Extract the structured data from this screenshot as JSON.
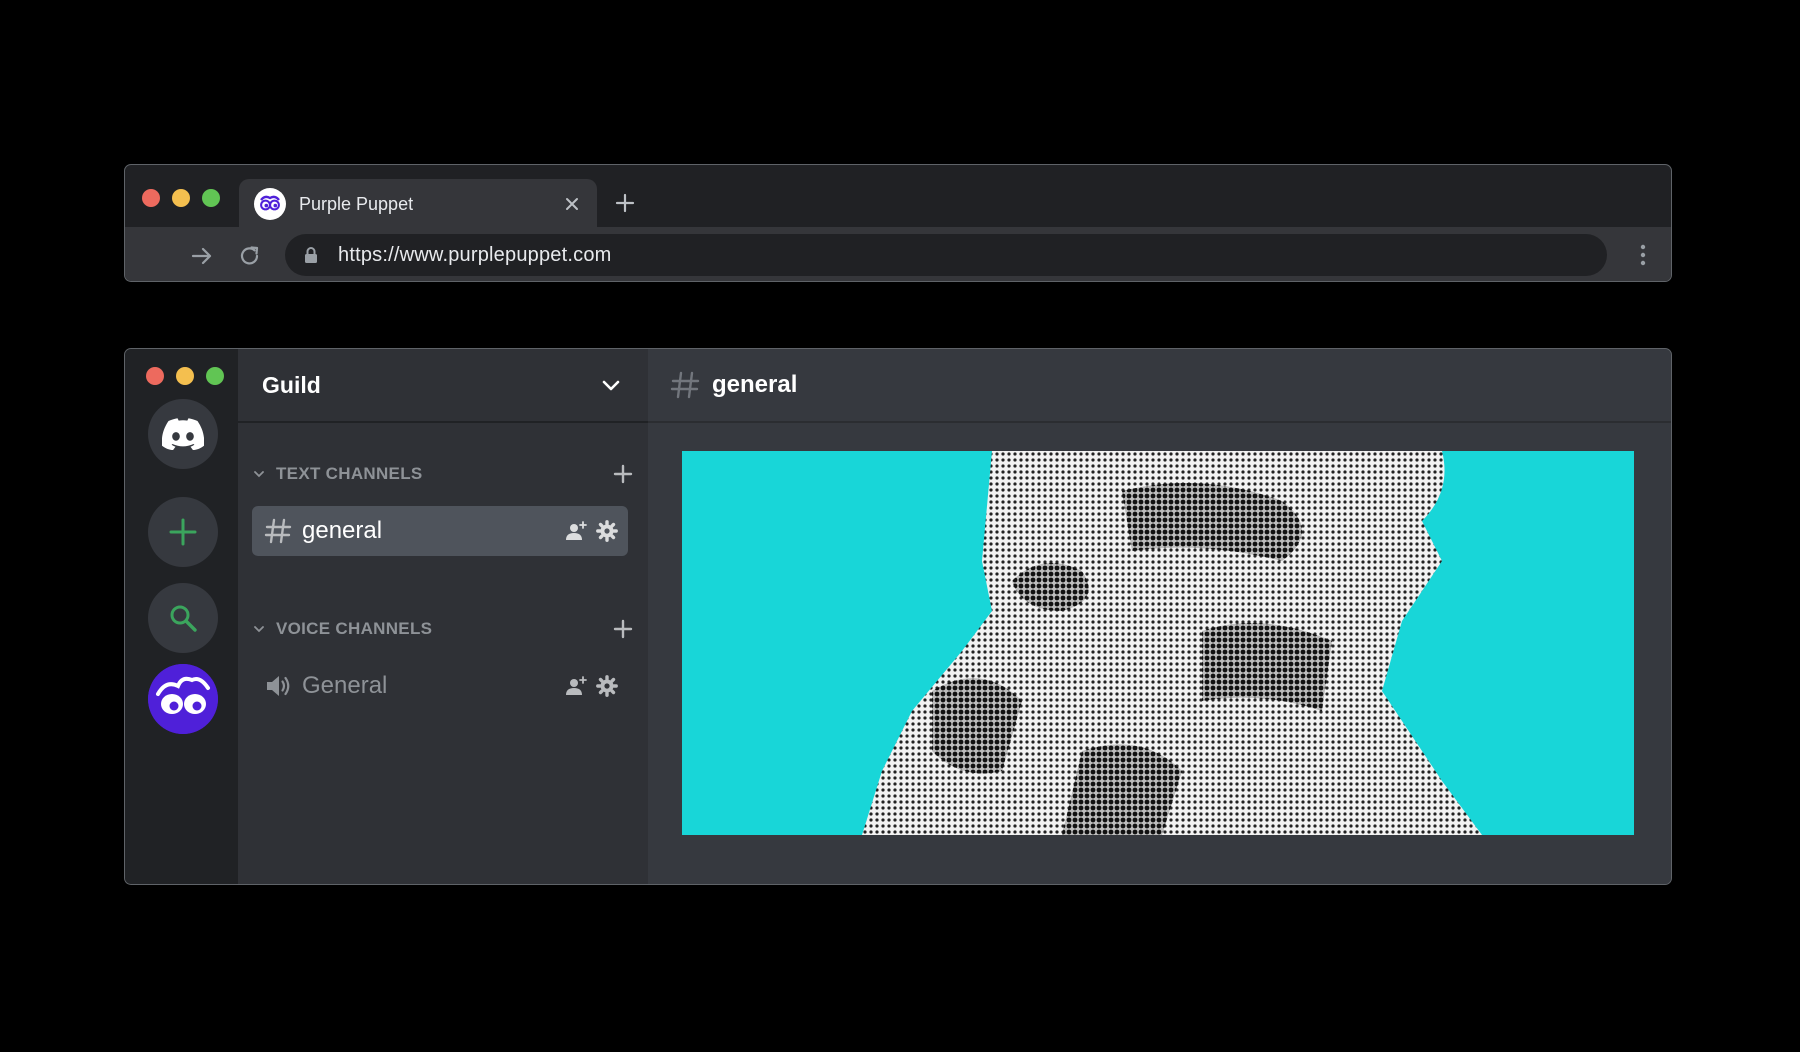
{
  "browser": {
    "tab": {
      "title": "Purple Puppet",
      "favicon_icon": "purple-puppet-logo-icon",
      "close_icon": "close-icon"
    },
    "new_tab_icon": "plus-icon",
    "toolbar": {
      "forward_icon": "arrow-right-icon",
      "reload_icon": "reload-icon",
      "lock_icon": "lock-icon",
      "url": "https://www.purplepuppet.com",
      "menu_icon": "kebab-menu-icon"
    }
  },
  "discord": {
    "guild_rail": {
      "items": [
        {
          "name": "home",
          "icon": "discord-logo-icon"
        },
        {
          "name": "add-server",
          "icon": "plus-icon"
        },
        {
          "name": "explore",
          "icon": "search-icon"
        },
        {
          "name": "purple-puppet-server",
          "icon": "purple-puppet-logo-icon"
        }
      ]
    },
    "guild": {
      "name": "Guild",
      "menu_icon": "chevron-down-icon"
    },
    "categories": [
      {
        "label": "TEXT CHANNELS",
        "channels": [
          {
            "name": "general",
            "type": "text",
            "selected": true
          }
        ]
      },
      {
        "label": "VOICE CHANNELS",
        "channels": [
          {
            "name": "General",
            "type": "voice",
            "selected": false
          }
        ]
      }
    ],
    "chat": {
      "channel_name": "general",
      "banner": {
        "description_icon": "halftone-astronaut-banner"
      }
    },
    "colors": {
      "rail": "#202225",
      "sidebar": "#2f3136",
      "chat": "#36393f",
      "selected": "#4f545c",
      "green": "#3ba55d",
      "purple": "#4f20d9",
      "banner": "#18d6d8"
    }
  }
}
